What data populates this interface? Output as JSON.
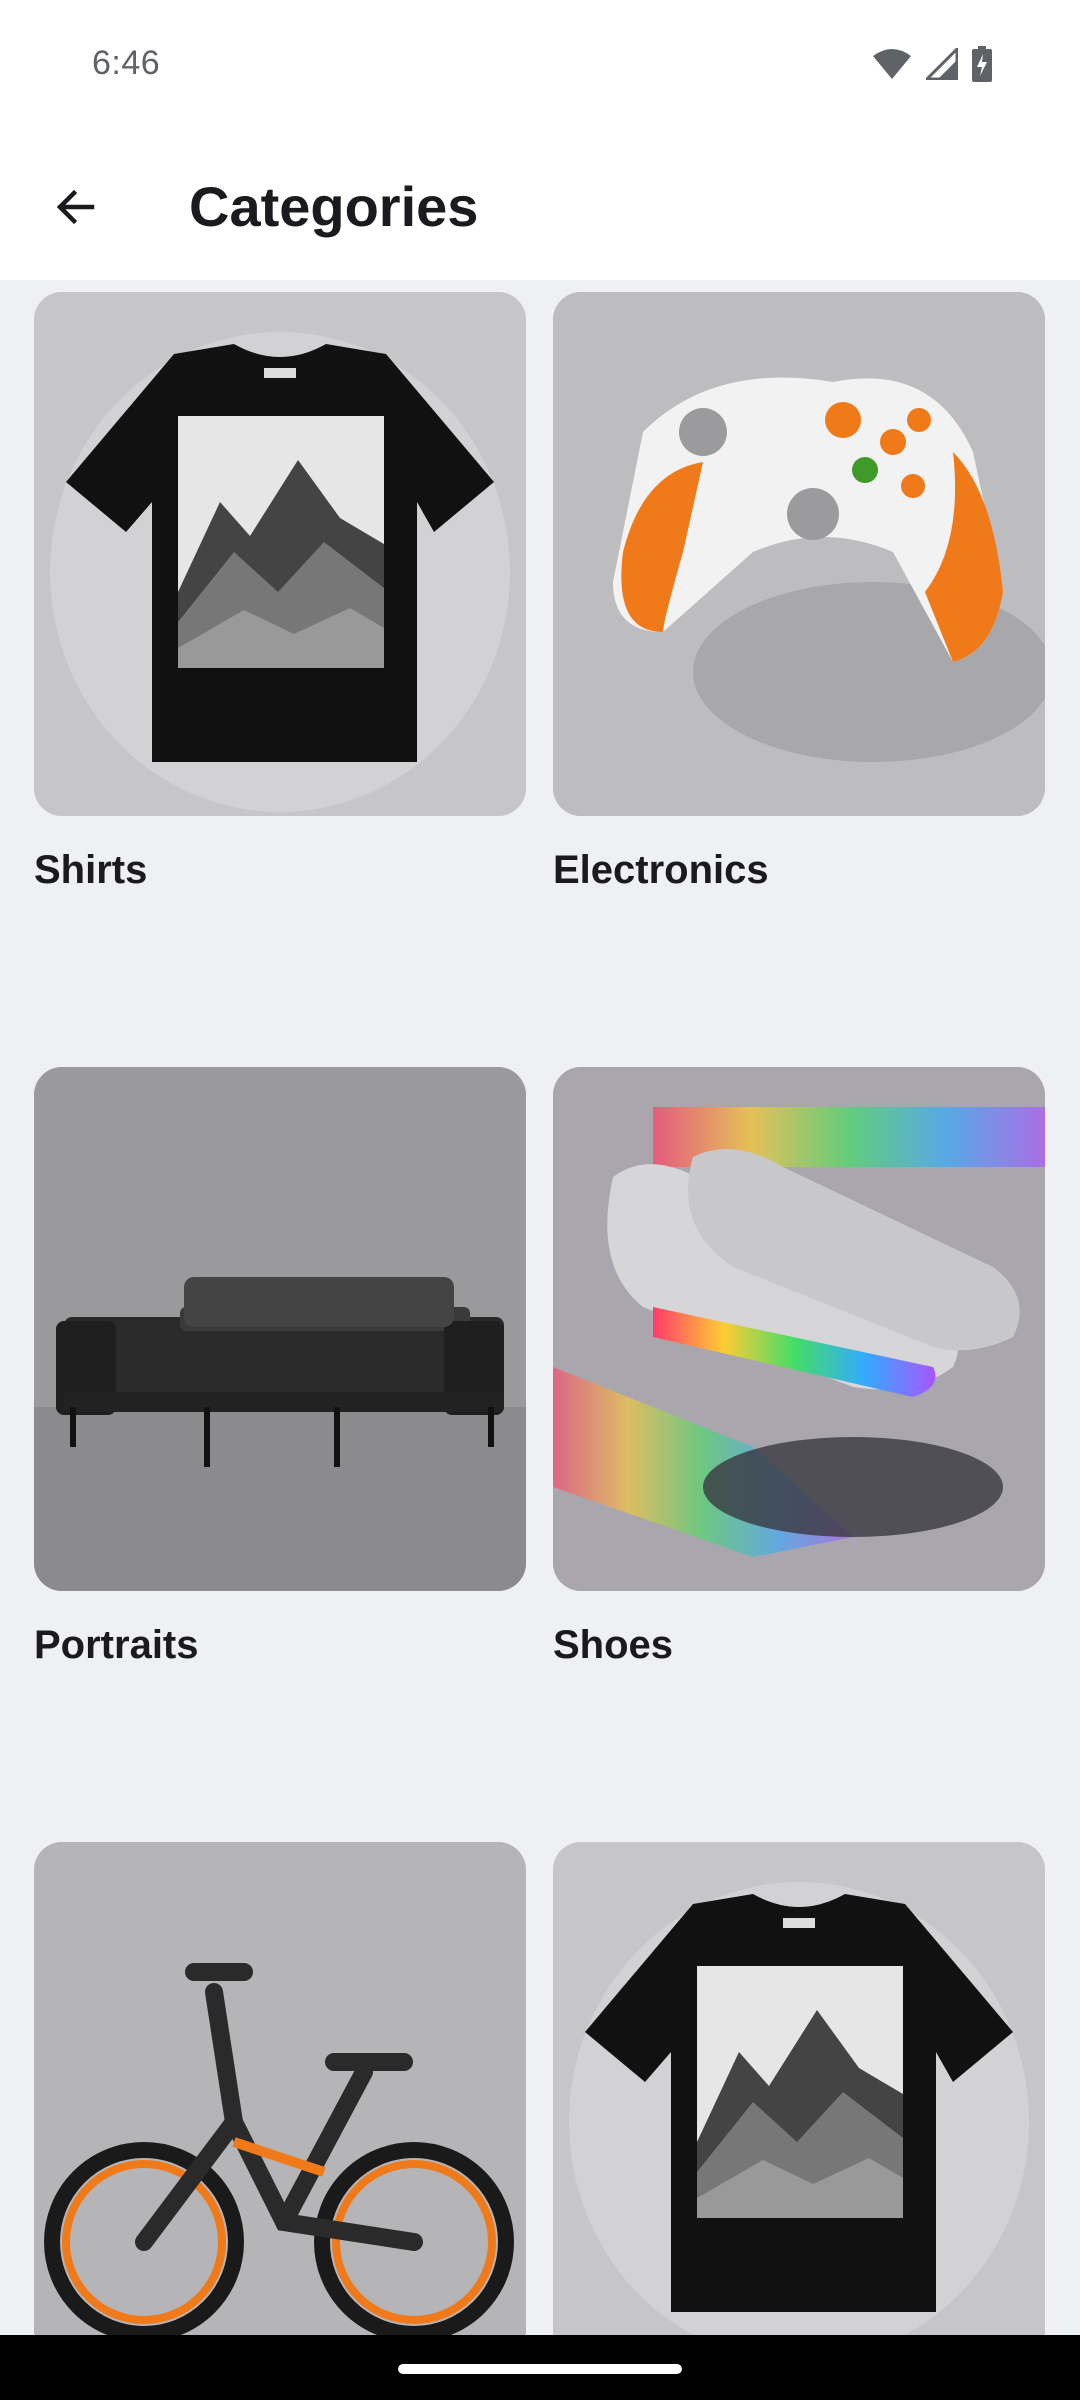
{
  "status_bar": {
    "time": "6:46",
    "icons": [
      "wifi-icon",
      "cell-signal-icon",
      "battery-charging-icon"
    ]
  },
  "app_bar": {
    "back_icon": "arrow-left-icon",
    "title": "Categories"
  },
  "categories": [
    {
      "label": "Shirts",
      "image": "black mountain t-shirt"
    },
    {
      "label": "Electronics",
      "image": "orange game controller"
    },
    {
      "label": "Portraits",
      "image": "black leather sofa"
    },
    {
      "label": "Shoes",
      "image": "iridescent silver sneakers"
    },
    {
      "label": "",
      "image": "orange electric bike"
    },
    {
      "label": "",
      "image": "black mountain t-shirt"
    }
  ],
  "colors": {
    "background": "#eef0f3",
    "surface": "#ffffff",
    "text": "#1b1b1f",
    "accent_orange": "#f07a1a"
  }
}
